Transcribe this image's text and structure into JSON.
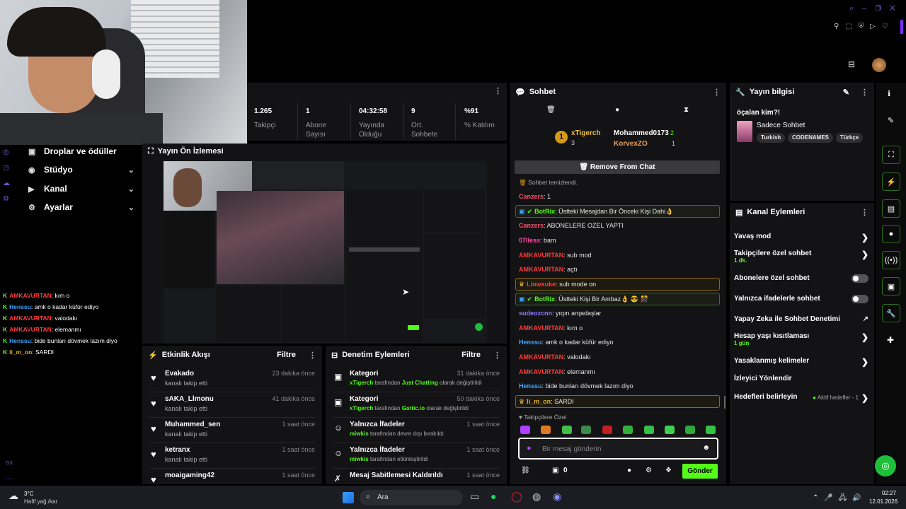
{
  "window": {
    "title_icons": [
      "search-icon",
      "restore-icon",
      "close-icon",
      "more-icon"
    ]
  },
  "stats": [
    {
      "value": "1.265",
      "label": "Takipçi"
    },
    {
      "value": "1",
      "label": "Abone Sayısı"
    },
    {
      "value": "04:32:58",
      "label": "Yayında Olduğu"
    },
    {
      "value": "9",
      "label": "Ort. Sohbete"
    },
    {
      "value": "%91",
      "label": "% Katılım"
    }
  ],
  "sidebar": {
    "items": [
      {
        "label": "Droplar ve ödüller"
      },
      {
        "label": "Stüdyo"
      },
      {
        "label": "Kanal"
      },
      {
        "label": "Ayarlar"
      }
    ]
  },
  "preview": {
    "title": "Yayın Ön İzlemesi"
  },
  "overlay_chat": [
    {
      "user": "AMKAVURTAN",
      "text": ": kım o",
      "color": "#ff3b3b"
    },
    {
      "user": "Henssu",
      "text": ": amk o kadar küfür ediyo",
      "color": "#3ea6ff"
    },
    {
      "user": "AMKAVURTAN",
      "text": ": valodakı",
      "color": "#ff3b3b"
    },
    {
      "user": "AMKAVURTAN",
      "text": ": elemanmı",
      "color": "#ff3b3b"
    },
    {
      "user": "Henssu",
      "text": ": bide bunları dövmek lazım diyo",
      "color": "#3ea6ff"
    },
    {
      "user": "li_m_on",
      "text": ": SARDI",
      "color": "#e0b020"
    }
  ],
  "gx": "GX",
  "activity": {
    "title": "Etkinlik Akışı",
    "filter": "Filtre",
    "items": [
      {
        "name": "Evakado",
        "sub": "kanalı takip etti",
        "time": "23 dakika önce"
      },
      {
        "name": "sAKA_Llmonu",
        "sub": "kanalı takip etti",
        "time": "41 dakika önce"
      },
      {
        "name": "Muhammed_sen",
        "sub": "kanalı takip etti",
        "time": "1 saat önce"
      },
      {
        "name": "ketranx",
        "sub": "kanalı takip etti",
        "time": "1 saat önce"
      },
      {
        "name": "moaigaming42",
        "sub": "",
        "time": "1 saat önce"
      }
    ]
  },
  "moderation": {
    "title": "Denetim Eylemleri",
    "filter": "Filtre",
    "items": [
      {
        "name": "Kategori",
        "who": "xTigerch",
        "mid": " tarafından ",
        "what": "Just Chatting",
        "end": " olarak değiştirildi",
        "time": "31 dakika önce"
      },
      {
        "name": "Kategori",
        "who": "xTigerch",
        "mid": " tarafından ",
        "what": "Gartic.io",
        "end": " olarak değiştirildi",
        "time": "50 dakika önce"
      },
      {
        "name": "Yalnızca İfadeler",
        "who": "miwkis",
        "mid": " tarafından devre dışı bırakıldı",
        "what": "",
        "end": "",
        "time": "1 saat önce"
      },
      {
        "name": "Yalnızca İfadeler",
        "who": "miwkis",
        "mid": " tarafından etkinleştirildi",
        "what": "",
        "end": "",
        "time": "1 saat önce"
      },
      {
        "name": "Mesaj Sabitlemesi Kaldırıldı",
        "who": "",
        "mid": "",
        "what": "",
        "end": "",
        "time": "1 saat önce"
      }
    ]
  },
  "chat": {
    "title": "Sohbet",
    "leaders": [
      {
        "name": "xTigerch",
        "count": "3"
      },
      {
        "name": "Mohammed0173",
        "count": "2"
      },
      {
        "name": "KorvexZO",
        "count": "1"
      }
    ],
    "remove_btn": "Remove From Chat",
    "cleared": "Sohbet temizlendi.",
    "messages": [
      {
        "user": "Canzers",
        "text": ": 1",
        "color": "#ff4d6d",
        "box": ""
      },
      {
        "user": "BotRix",
        "text": ": Üstteki Mesajdan Bir Önceki Kişi Dahi👌",
        "color": "#53fc18",
        "box": "green"
      },
      {
        "user": "Canzers",
        "text": ": ABONELERE OZEL YAPTI",
        "color": "#ff4d6d",
        "box": ""
      },
      {
        "user": "07lless",
        "text": ": bam",
        "color": "#ff4da6",
        "box": ""
      },
      {
        "user": "AMKAVURTAN",
        "text": ": sub mod",
        "color": "#ff3b3b",
        "box": ""
      },
      {
        "user": "AMKAVURTAN",
        "text": ": açtı",
        "color": "#ff3b3b",
        "box": ""
      },
      {
        "user": "Linwsuke",
        "text": ": sub mode on",
        "color": "#ff3b3b",
        "box": "yellow"
      },
      {
        "user": "BotRix",
        "text": ": Üstteki Kişi Bir Ambaz👌 😎 🎊",
        "color": "#53fc18",
        "box": "green"
      },
      {
        "user": "sudeozcnn",
        "text": ": yıqın arqadaşlar",
        "color": "#8c7bff",
        "box": ""
      },
      {
        "user": "AMKAVURTAN",
        "text": ": kım o",
        "color": "#ff3b3b",
        "box": ""
      },
      {
        "user": "Henssu",
        "text": ": amk o kadar küfür ediyo",
        "color": "#3ea6ff",
        "box": ""
      },
      {
        "user": "AMKAVURTAN",
        "text": ": valodakı",
        "color": "#ff3b3b",
        "box": ""
      },
      {
        "user": "AMKAVURTAN",
        "text": ": elemanmı",
        "color": "#ff3b3b",
        "box": ""
      },
      {
        "user": "Henssu",
        "text": ": bide bunları dövmek lazım diyo",
        "color": "#3ea6ff",
        "box": ""
      },
      {
        "user": "li_m_on",
        "text": ": SARDI",
        "color": "#e0b020",
        "box": "yellow"
      }
    ],
    "emote_label": "Takipçilere Özel",
    "input_placeholder": "Bir mesaj gönderin",
    "count": "0",
    "send": "Gönder"
  },
  "info": {
    "title": "Yayın bilgisi",
    "stream_title": "öçalan kim?!",
    "category": "Sadece Sohbet",
    "tags": [
      "Turkish",
      "CODENAMES",
      "Türkçe"
    ]
  },
  "actions": {
    "title": "Kanal Eylemleri",
    "items": [
      {
        "label": "Yavaş mod",
        "sub": "",
        "ctrl": "chev"
      },
      {
        "label": "Takipçilere özel sohbet",
        "sub": "1 dk.",
        "ctrl": "chev"
      },
      {
        "label": "Abonelere özel sohbet",
        "sub": "",
        "ctrl": "toggle"
      },
      {
        "label": "Yalnızca ifadelerle sohbet",
        "sub": "",
        "ctrl": "toggle"
      },
      {
        "label": "Yapay Zeka ile Sohbet Denetimi",
        "sub": "",
        "ctrl": "ext"
      },
      {
        "label": "Hesap yaşı kısıtlaması",
        "sub": "1 gün",
        "ctrl": "chev"
      },
      {
        "label": "Yasaklanmış kelimeler",
        "sub": "",
        "ctrl": "chev"
      },
      {
        "label": "İzleyici Yönlendir",
        "sub": "",
        "ctrl": ""
      },
      {
        "label": "Hedefleri belirleyin",
        "sub": "",
        "ctrl": "chev"
      }
    ],
    "goals_status": "Aktif hedefler - 1"
  },
  "taskbar": {
    "temp": "3°C",
    "weather": "Hafif yağ./kar",
    "search": "Ara",
    "time": "02:27",
    "date": "12.01.2026"
  },
  "colors": {
    "accent": "#53fc18",
    "panel": "#131315",
    "bg": "#000000"
  }
}
